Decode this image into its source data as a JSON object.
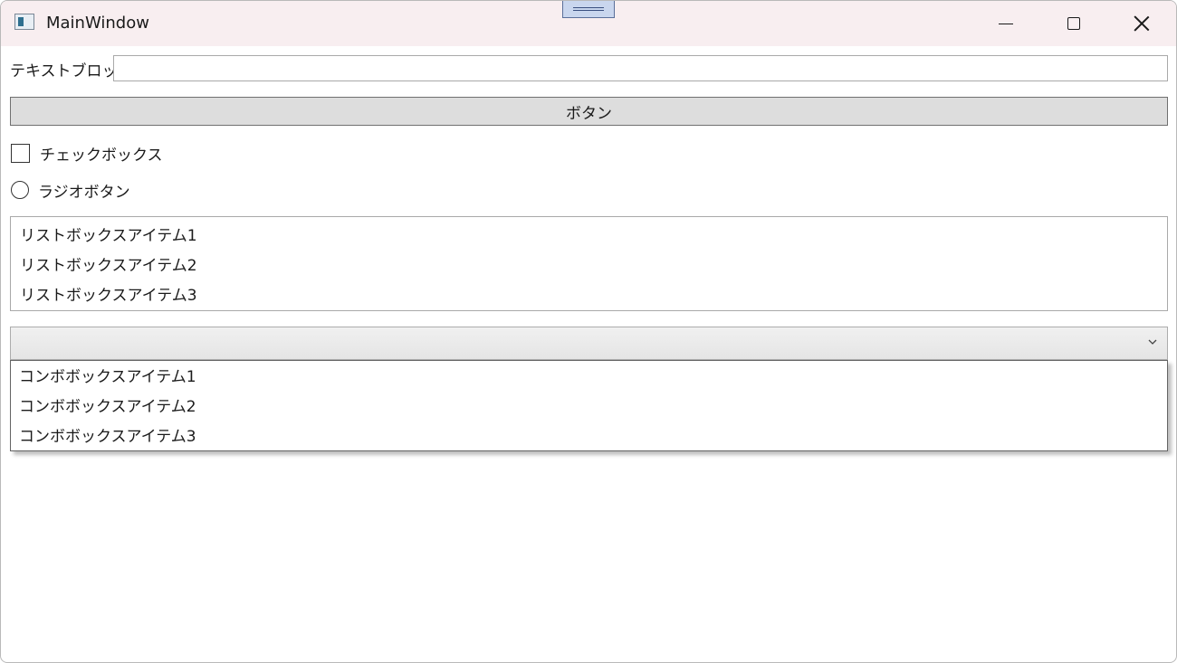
{
  "window": {
    "title": "MainWindow"
  },
  "caption_buttons": {
    "minimize_icon": "minimize-icon",
    "maximize_icon": "maximize-icon",
    "close_icon": "close-icon"
  },
  "form": {
    "textblock_label": "テキストブロック",
    "textbox_value": "",
    "button_label": "ボタン",
    "checkbox_label": "チェックボックス",
    "checkbox_checked": false,
    "radio_label": "ラジオボタン",
    "radio_checked": false,
    "listbox_items": [
      "リストボックスアイテム1",
      "リストボックスアイテム2",
      "リストボックスアイテム3"
    ],
    "combobox_selected": "",
    "combobox_items": [
      "コンボボックスアイテム1",
      "コンボボックスアイテム2",
      "コンボボックスアイテム3"
    ]
  }
}
